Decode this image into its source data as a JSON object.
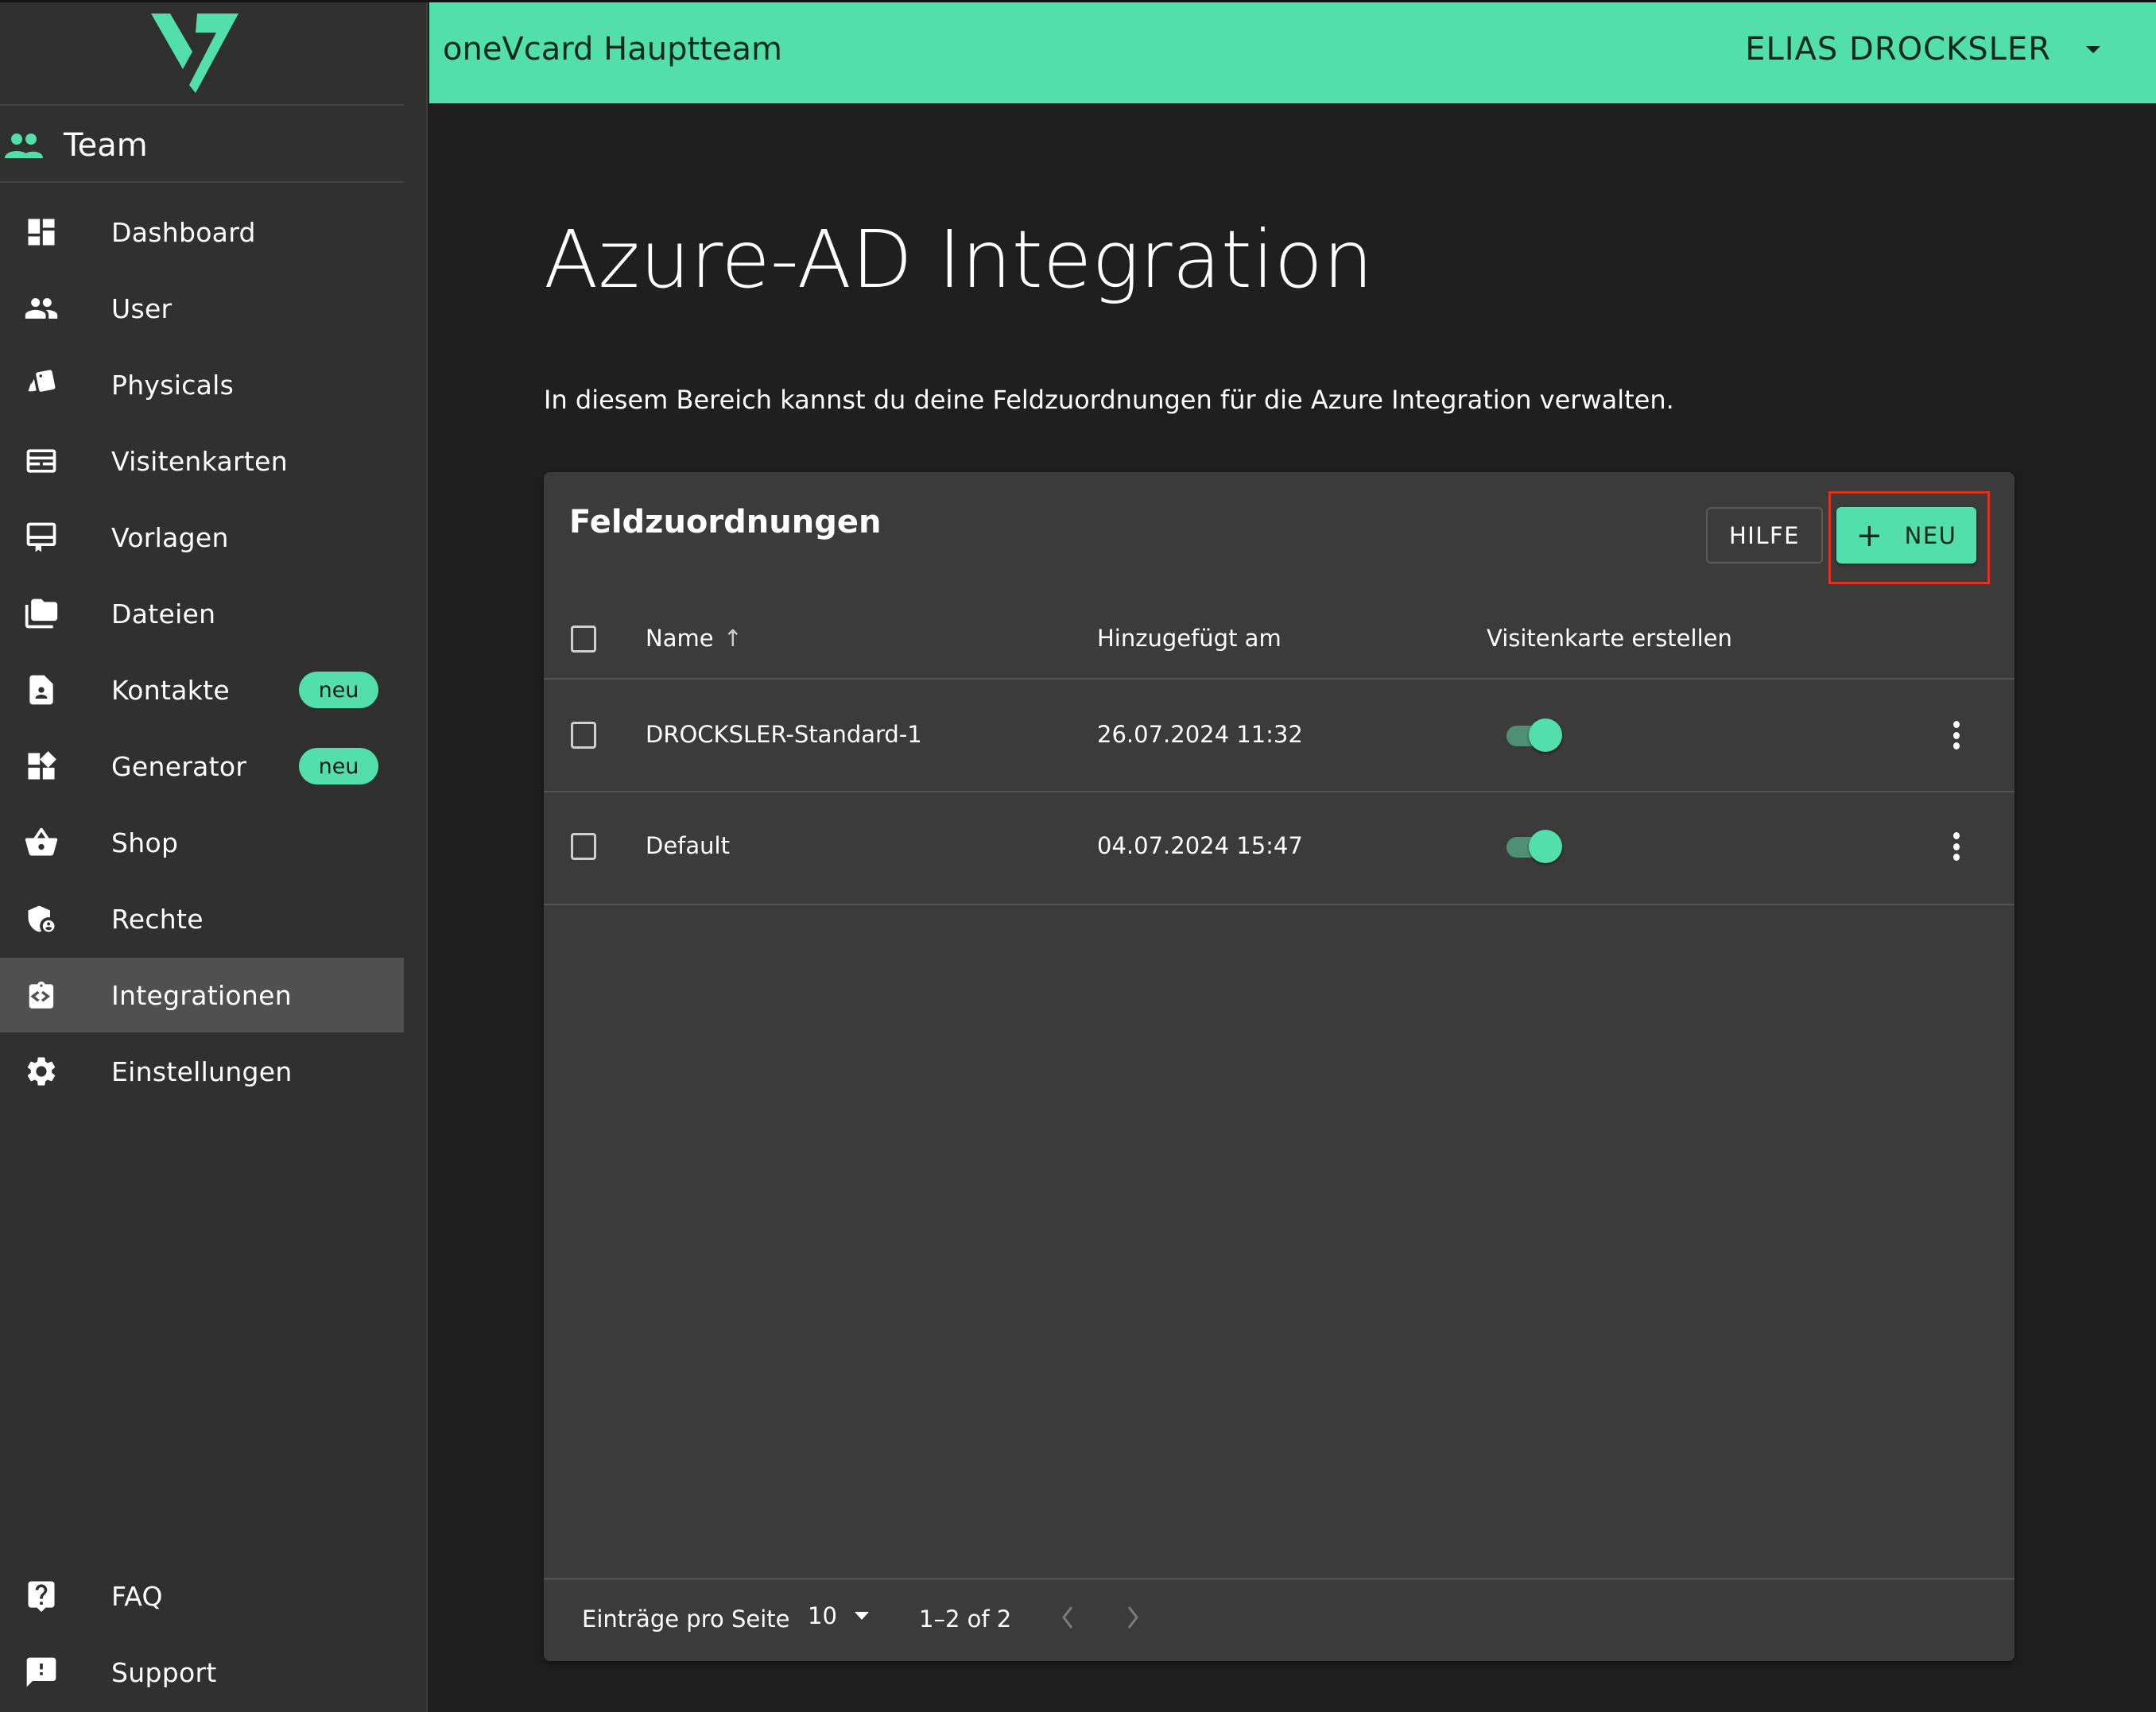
{
  "app": {
    "brand_color": "#52dfab",
    "logo_icon": "onevcard-v-logo"
  },
  "header": {
    "team_name": "oneVcard Hauptteam",
    "user_name": "ELIAS DROCKSLER",
    "user_menu_icon": "caret-down-icon"
  },
  "sidebar": {
    "team": {
      "label": "Team",
      "icon": "team-icon"
    },
    "items": [
      {
        "label": "Dashboard",
        "icon": "dashboard-icon",
        "badge": null,
        "active": false
      },
      {
        "label": "User",
        "icon": "users-icon",
        "badge": null,
        "active": false
      },
      {
        "label": "Physicals",
        "icon": "cards-icon",
        "badge": null,
        "active": false
      },
      {
        "label": "Visitenkarten",
        "icon": "business-card-icon",
        "badge": null,
        "active": false
      },
      {
        "label": "Vorlagen",
        "icon": "template-icon",
        "badge": null,
        "active": false
      },
      {
        "label": "Dateien",
        "icon": "folders-icon",
        "badge": null,
        "active": false
      },
      {
        "label": "Kontakte",
        "icon": "contact-file-icon",
        "badge": "neu",
        "active": false
      },
      {
        "label": "Generator",
        "icon": "widgets-icon",
        "badge": "neu",
        "active": false
      },
      {
        "label": "Shop",
        "icon": "basket-icon",
        "badge": null,
        "active": false
      },
      {
        "label": "Rechte",
        "icon": "shield-user-icon",
        "badge": null,
        "active": false
      },
      {
        "label": "Integrationen",
        "icon": "integration-icon",
        "badge": null,
        "active": true
      },
      {
        "label": "Einstellungen",
        "icon": "gear-icon",
        "badge": null,
        "active": false
      }
    ],
    "bottom_items": [
      {
        "label": "FAQ",
        "icon": "help-bubble-icon"
      },
      {
        "label": "Support",
        "icon": "feedback-icon"
      }
    ]
  },
  "main": {
    "title": "Azure-AD Integration",
    "description": "In diesem Bereich kannst du deine Feldzuordnungen für die Azure Integration verwalten.",
    "card": {
      "title": "Feldzuordnungen",
      "help_button": "HILFE",
      "new_button": "NEU",
      "new_button_icon": "plus-icon",
      "highlight_color": "#e0301e",
      "columns": [
        {
          "label": "Name",
          "sort": "ascending"
        },
        {
          "label": "Hinzugefügt am"
        },
        {
          "label": "Visitenkarte erstellen"
        }
      ],
      "rows": [
        {
          "name": "DROCKSLER-Standard-1",
          "added": "26.07.2024 11:32",
          "create_card": true,
          "selected": false
        },
        {
          "name": "Default",
          "added": "04.07.2024 15:47",
          "create_card": true,
          "selected": false
        }
      ],
      "pagination": {
        "per_page_label": "Einträge pro Seite",
        "per_page_value": "10",
        "range": "1–2 of 2",
        "prev_enabled": false,
        "next_enabled": false
      }
    }
  }
}
